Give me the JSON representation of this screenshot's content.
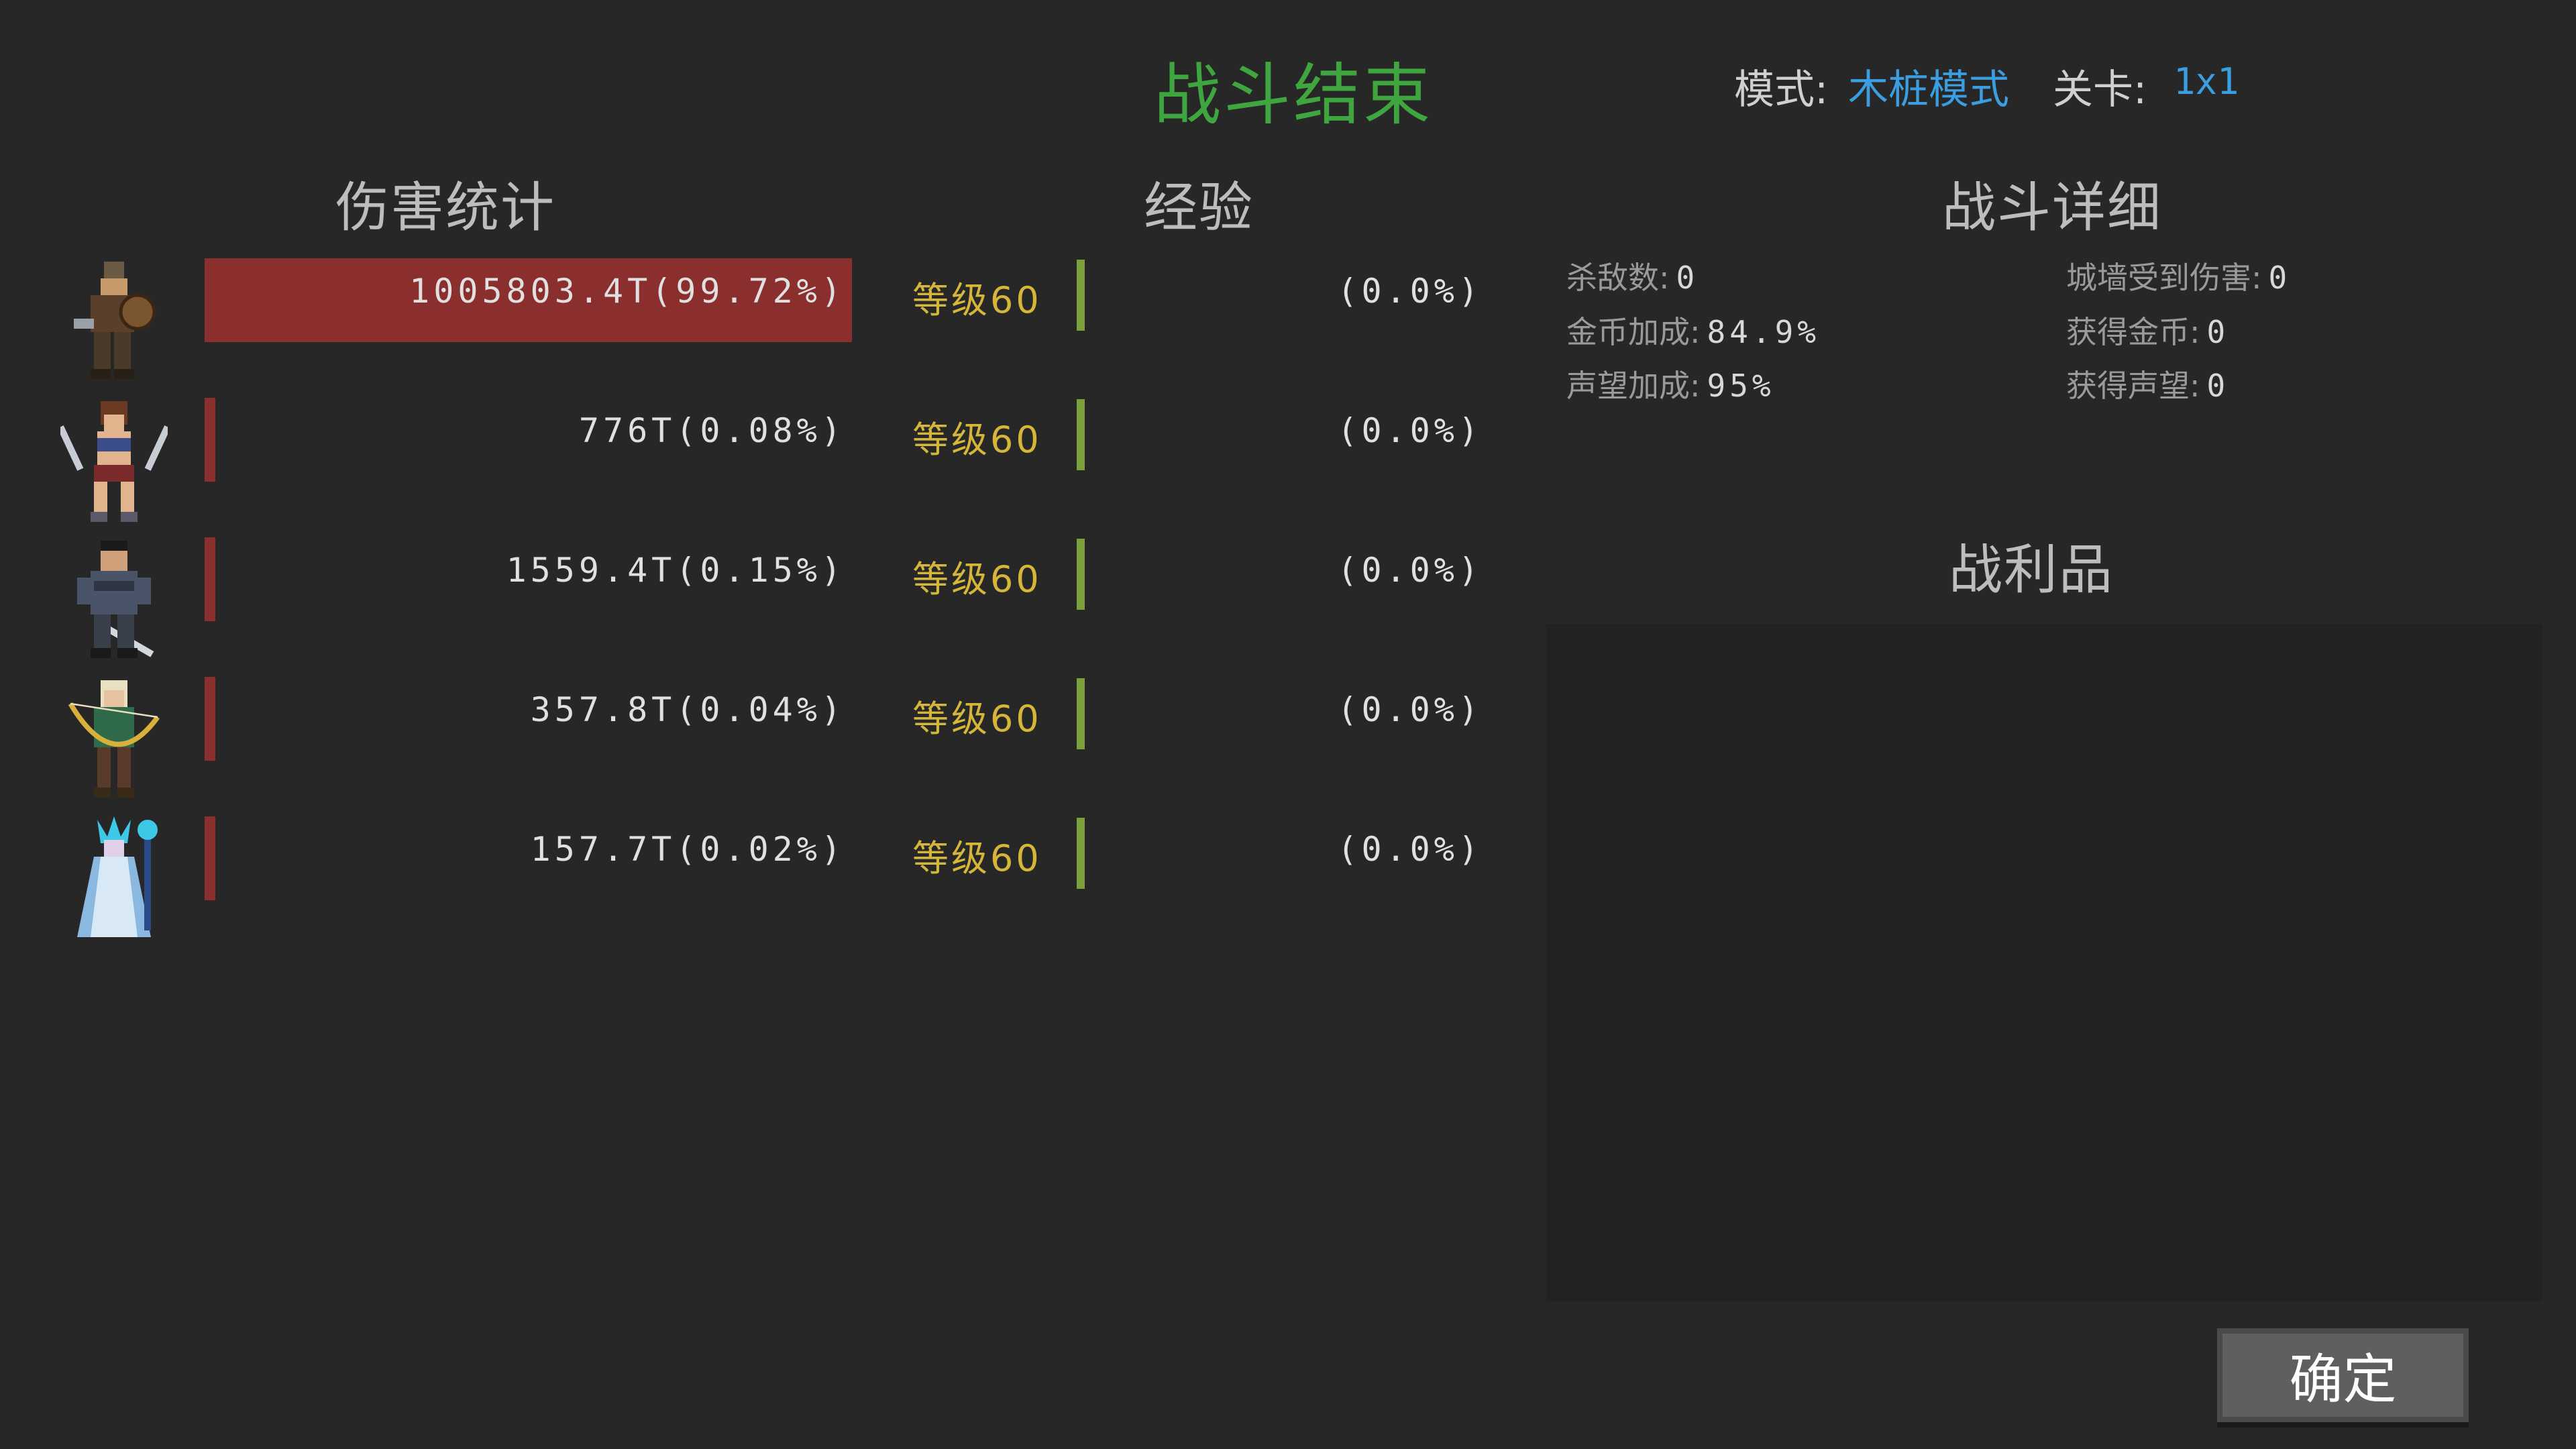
{
  "header": {
    "title": "战斗结束",
    "mode_label": "模式:",
    "mode_value": "木桩模式",
    "stage_label": "关卡:",
    "stage_value": "1x1"
  },
  "sections": {
    "damage": "伤害统计",
    "experience": "经验",
    "details": "战斗详细",
    "loot": "战利品"
  },
  "heroes": [
    {
      "portrait": "warrior-shield-portrait",
      "damage": "1005803.4T(99.72%)",
      "damage_share": 0.9972,
      "level": "等级60",
      "exp": "(0.0%)"
    },
    {
      "portrait": "dual-blade-woman-portrait",
      "damage": "776T(0.08%)",
      "damage_share": 0.0008,
      "level": "等级60",
      "exp": "(0.0%)"
    },
    {
      "portrait": "swordsman-portrait",
      "damage": "1559.4T(0.15%)",
      "damage_share": 0.0015,
      "level": "等级60",
      "exp": "(0.0%)"
    },
    {
      "portrait": "elf-archer-portrait",
      "damage": "357.8T(0.04%)",
      "damage_share": 0.0004,
      "level": "等级60",
      "exp": "(0.0%)"
    },
    {
      "portrait": "ice-mage-portrait",
      "damage": "157.7T(0.02%)",
      "damage_share": 0.0002,
      "level": "等级60",
      "exp": "(0.0%)"
    }
  ],
  "details": {
    "kills_label": "杀敌数:",
    "kills": "0",
    "wall_damage_label": "城墙受到伤害:",
    "wall_damage": "0",
    "gold_bonus_label": "金币加成:",
    "gold_bonus": "84.9%",
    "gold_gained_label": "获得金币:",
    "gold_gained": "0",
    "fame_bonus_label": "声望加成:",
    "fame_bonus": "95%",
    "fame_gained_label": "获得声望:",
    "fame_gained": "0"
  },
  "confirm_label": "确定",
  "colors": {
    "background": "#272727",
    "title": "#3fa63f",
    "link": "#3b9ee0",
    "damage_bar": "#8a2e2e",
    "exp_bar": "#7ca03b",
    "level": "#d4b63b"
  }
}
